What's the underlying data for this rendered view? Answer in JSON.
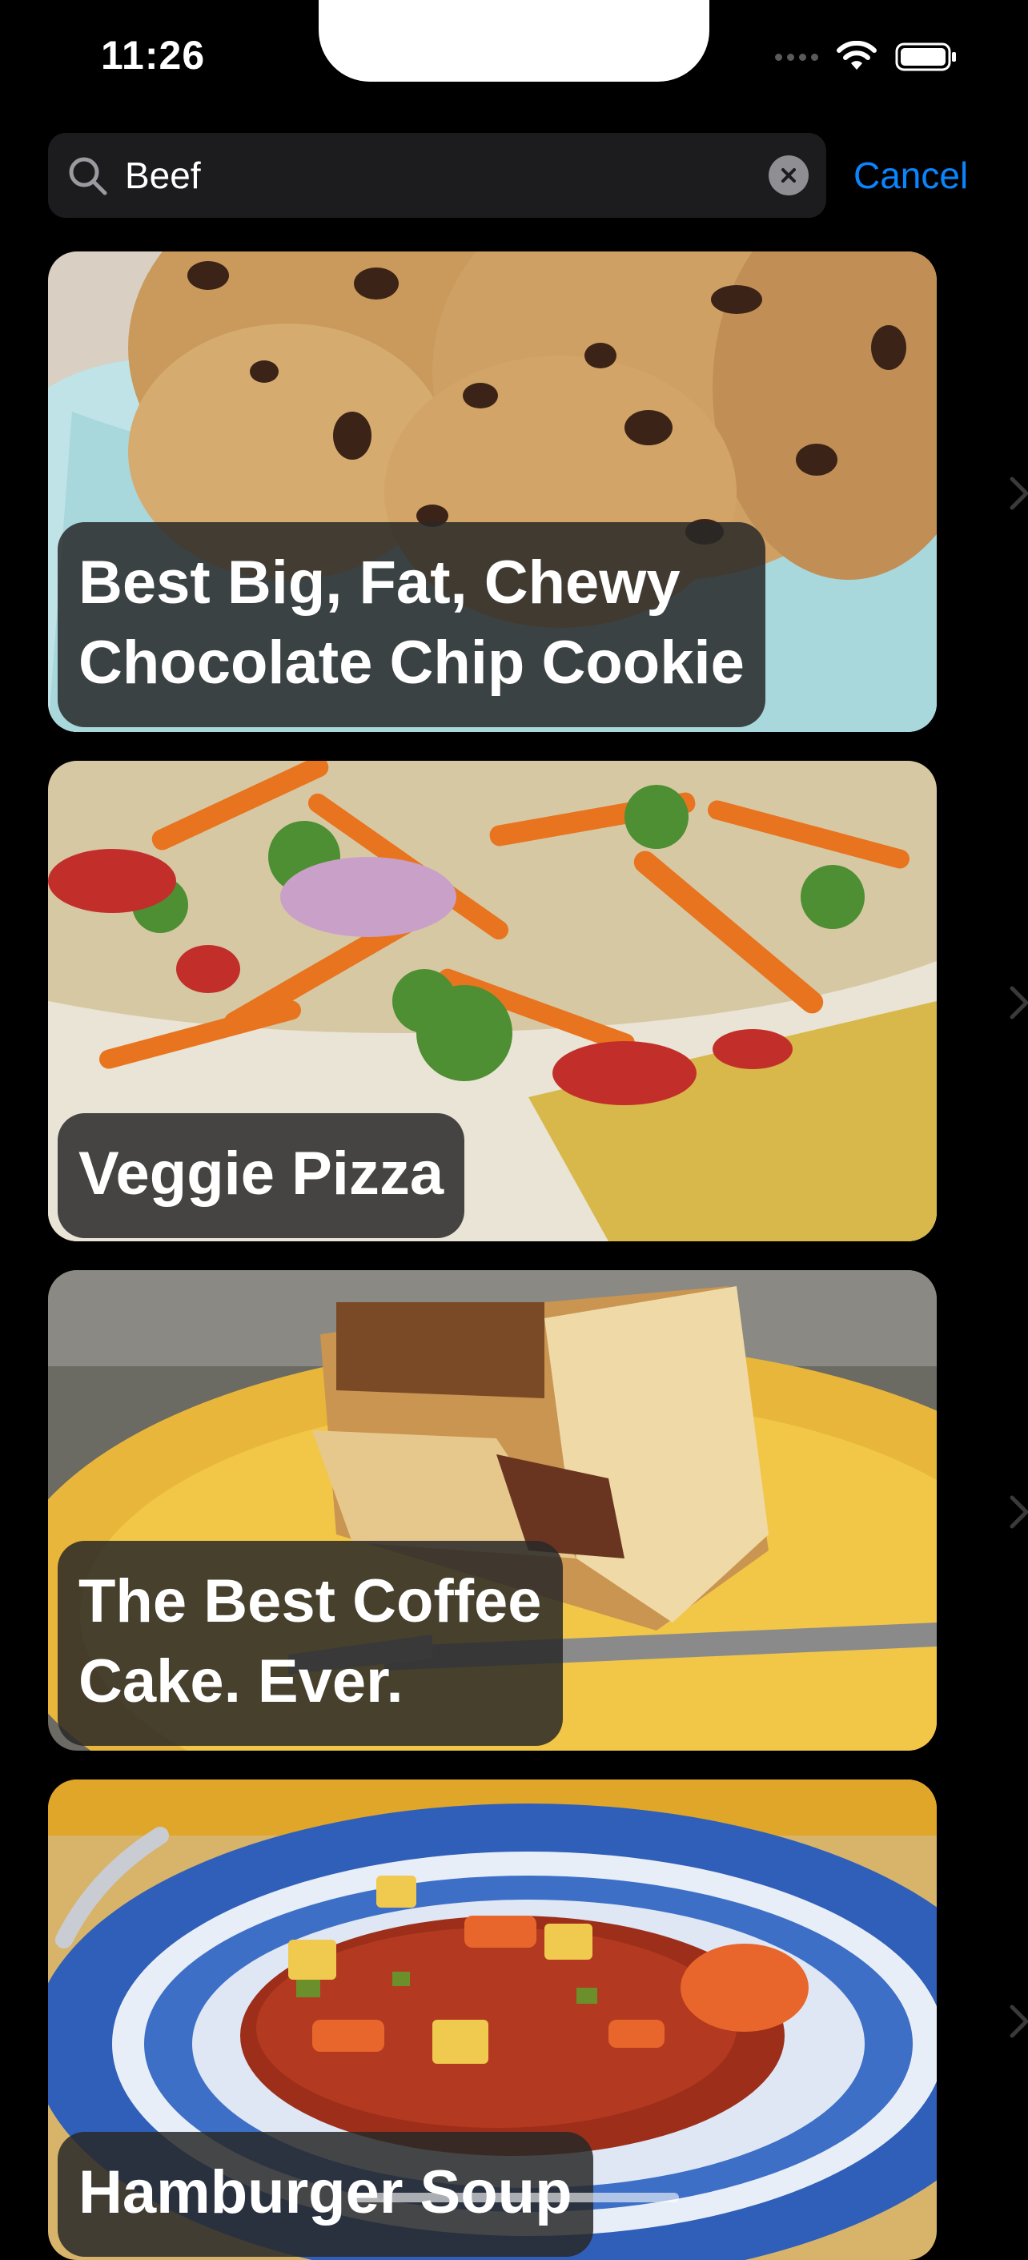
{
  "status_bar": {
    "time": "11:26"
  },
  "search": {
    "query": "Beef",
    "cancel_label": "Cancel"
  },
  "recipes": [
    {
      "title": "Best Big, Fat, Chewy\nChocolate Chip Cookie"
    },
    {
      "title": "Veggie Pizza"
    },
    {
      "title": "The Best Coffee\nCake. Ever."
    },
    {
      "title": "Hamburger Soup"
    }
  ],
  "colors": {
    "accent": "#0a84ff",
    "background": "#000000",
    "search_field": "#1c1c1e"
  }
}
